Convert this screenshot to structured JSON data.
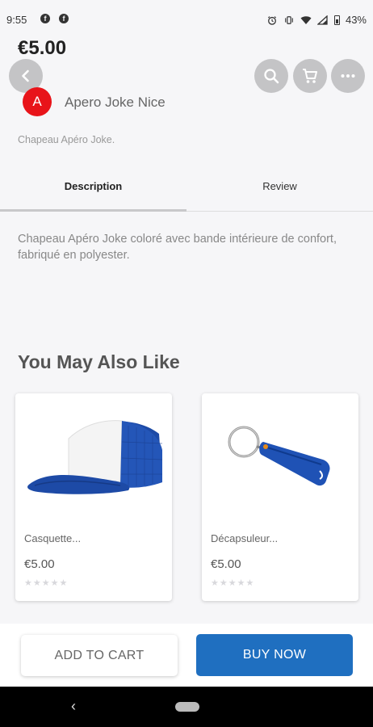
{
  "status_bar": {
    "time": "9:55",
    "battery": "43%",
    "icons": [
      "facebook-icon",
      "facebook-icon",
      "alarm-icon",
      "vibrate-icon",
      "wifi-icon",
      "signal-icon",
      "battery-icon"
    ]
  },
  "product": {
    "price": "€5.00",
    "brand_initial": "A",
    "brand_name": "Apero Joke Nice",
    "short_description": "Chapeau Apéro Joke.",
    "description": "Chapeau Apéro Joke coloré avec bande intérieure de confort, fabriqué en polyester."
  },
  "header": {
    "icons": [
      "back-icon",
      "search-icon",
      "cart-icon",
      "more-icon"
    ]
  },
  "tabs": [
    {
      "label": "Description",
      "active": true
    },
    {
      "label": "Review",
      "active": false
    }
  ],
  "related": {
    "title": "You May Also Like",
    "items": [
      {
        "name": "Casquette...",
        "price": "€5.00",
        "stars": "★★★★★",
        "rating": 0,
        "image": "blue-white-cap"
      },
      {
        "name": "Décapsuleur...",
        "price": "€5.00",
        "stars": "★★★★★",
        "rating": 0,
        "image": "blue-bottle-opener-keychain"
      }
    ]
  },
  "actions": {
    "add_to_cart": "ADD TO CART",
    "buy_now": "BUY NOW"
  },
  "colors": {
    "accent": "#1f6fc0",
    "brand_avatar": "#e8141a",
    "background": "#f6f6f8"
  },
  "nav": {
    "back_glyph": "‹"
  }
}
